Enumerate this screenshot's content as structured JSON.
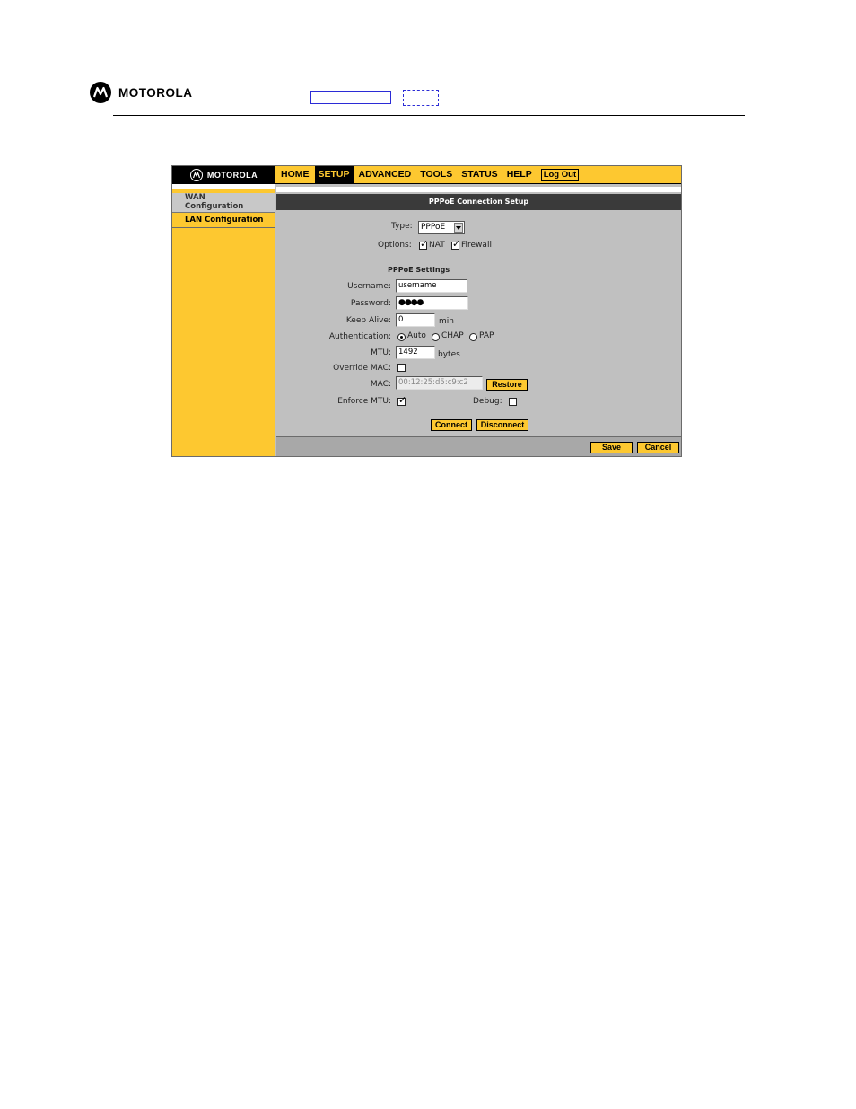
{
  "doc_header": {
    "brand": "MOTOROLA"
  },
  "app": {
    "brand": "MOTOROLA",
    "nav": [
      "HOME",
      "SETUP",
      "ADVANCED",
      "TOOLS",
      "STATUS",
      "HELP"
    ],
    "active_nav": "SETUP",
    "logout_label": "Log Out",
    "sidebar": {
      "wan_line1": "WAN",
      "wan_line2": "Configuration",
      "lan": "LAN Configuration"
    },
    "section_title": "PPPoE Connection Setup",
    "type_label": "Type:",
    "type_value": "PPPoE",
    "options_label": "Options:",
    "nat_label": "NAT",
    "firewall_label": "Firewall",
    "nat_checked": true,
    "firewall_checked": true,
    "pppoe_settings_heading": "PPPoE Settings",
    "username_label": "Username:",
    "username_value": "username",
    "password_label": "Password:",
    "password_value": "●●●●",
    "keepalive_label": "Keep Alive:",
    "keepalive_value": "0",
    "keepalive_unit": "min",
    "auth_label": "Authentication:",
    "auth_auto": "Auto",
    "auth_chap": "CHAP",
    "auth_pap": "PAP",
    "auth_selected": "Auto",
    "mtu_label": "MTU:",
    "mtu_value": "1492",
    "mtu_unit": "bytes",
    "override_mac_label": "Override MAC:",
    "override_mac_checked": false,
    "mac_label": "MAC:",
    "mac_value": "00:12:25:d5:c9:c2",
    "restore_label": "Restore",
    "enforce_mtu_label": "Enforce MTU:",
    "enforce_mtu_checked": true,
    "debug_label": "Debug:",
    "debug_checked": false,
    "connect_label": "Connect",
    "disconnect_label": "Disconnect",
    "save_label": "Save",
    "cancel_label": "Cancel"
  },
  "colors": {
    "accent": "#fdc830",
    "panel": "#c0c0c0",
    "title_bar": "#3a3a3a"
  }
}
